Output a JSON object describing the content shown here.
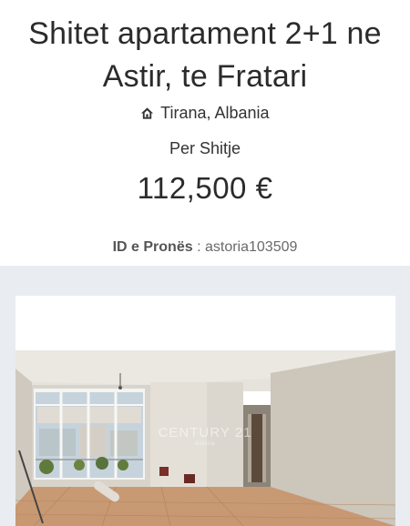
{
  "listing": {
    "title": "Shitet apartament 2+1 ne Astir, te Fratari",
    "location": "Tirana, Albania",
    "location_icon": "home-icon",
    "listing_type": "Per Shitje",
    "price": "112,500 €",
    "property_id_label": "ID e Pronës",
    "property_id_separator": " : ",
    "property_id_value": "astoria103509"
  },
  "photo": {
    "watermark_brand": "CENTURY 21",
    "watermark_sub": "Astoria"
  },
  "colors": {
    "background_band": "#e9edf2",
    "card": "#ffffff",
    "text": "#2b2b2b"
  }
}
